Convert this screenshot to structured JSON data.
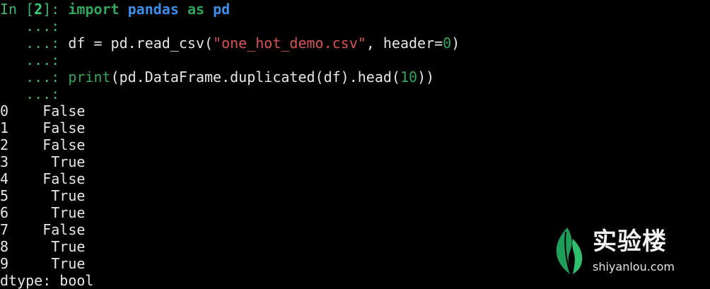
{
  "terminal": {
    "in_prompt": {
      "in_label": "In [",
      "exec_count": "2",
      "close": "]: "
    },
    "code_line_1": {
      "import_kw": "import",
      "module": "pandas",
      "as_kw": "as",
      "alias": "pd"
    },
    "continuation_prompt": "   ...:",
    "code_line_2": {
      "before_string": " df = pd.read_csv(",
      "string_literal": "\"one_hot_demo.csv\"",
      "middle": ", header=",
      "number": "0",
      "after": ")"
    },
    "code_line_3": {
      "print_fn": "print",
      "before_number": "(pd.DataFrame.duplicated(df).head(",
      "number": "10",
      "after": "))"
    },
    "output_rows": [
      {
        "index": "0",
        "value": "False"
      },
      {
        "index": "1",
        "value": "False"
      },
      {
        "index": "2",
        "value": "False"
      },
      {
        "index": "3",
        "value": "True"
      },
      {
        "index": "4",
        "value": "False"
      },
      {
        "index": "5",
        "value": "True"
      },
      {
        "index": "6",
        "value": "True"
      },
      {
        "index": "7",
        "value": "False"
      },
      {
        "index": "8",
        "value": "True"
      },
      {
        "index": "9",
        "value": "True"
      }
    ],
    "dtype_line": "dtype: bool"
  },
  "watermark": {
    "brand_name": "实验楼",
    "domain": "shiyanlou.com",
    "logo_icon": "shiyanlou-leaf-logo",
    "logo_color": "#1f9e5a"
  },
  "colors": {
    "background": "#000000",
    "prompt_green": "#3cb371",
    "keyword_green": "#2fa65a",
    "module_blue": "#3b8eea",
    "string_red": "#d9534f",
    "text": "#e6e6e6"
  }
}
